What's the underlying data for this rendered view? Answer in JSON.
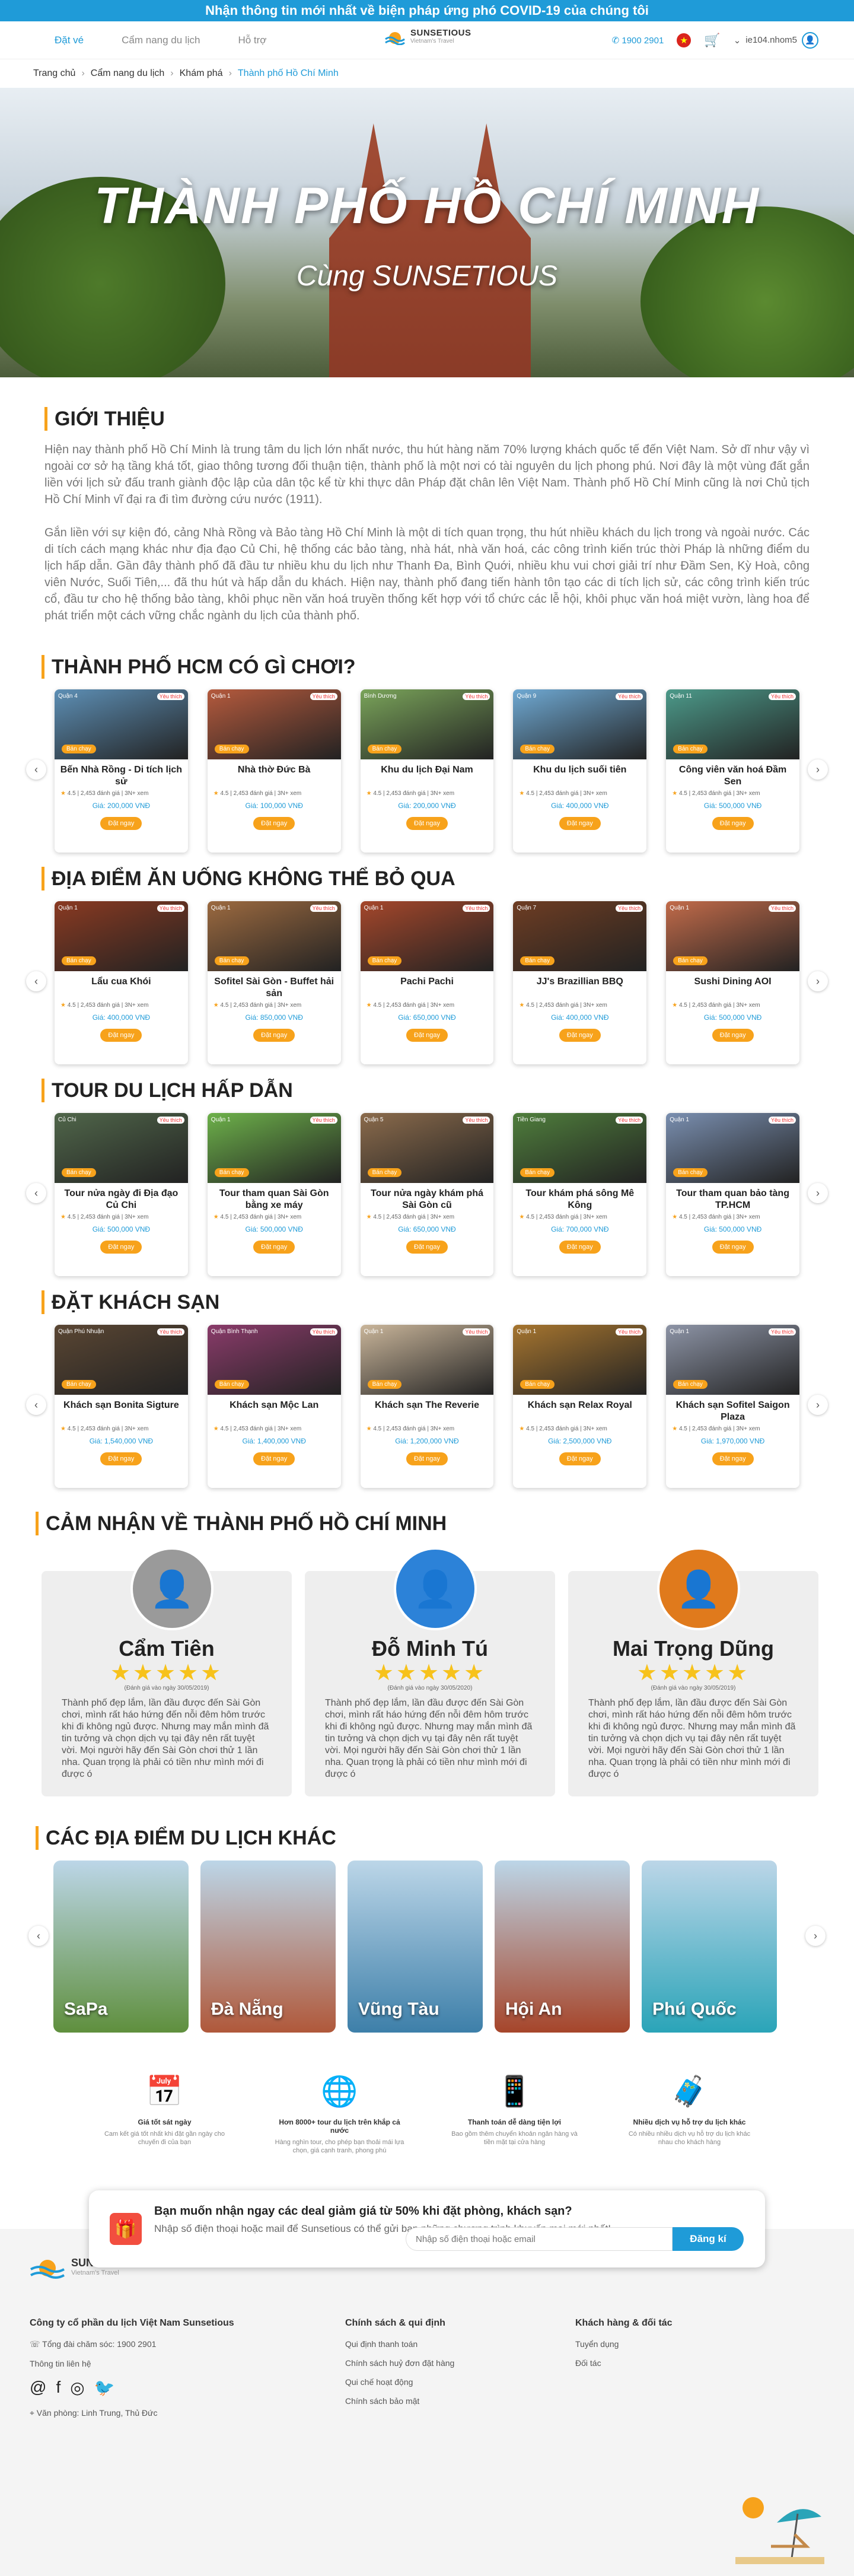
{
  "topbar": "Nhận thông tin mới nhất về biện pháp ứng phó COVID-19 của chúng tôi",
  "nav": {
    "links": [
      "Đặt vé",
      "Cẩm nang du lịch",
      "Hỗ trợ"
    ],
    "logo_title": "SUNSETIOUS",
    "logo_sub": "Vietnam's Travel",
    "phone": "1900 2901",
    "user": "ie104.nhom5"
  },
  "breadcrumb": [
    "Trang chủ",
    "Cẩm nang du lịch",
    "Khám phá",
    "Thành phố Hồ Chí Minh"
  ],
  "hero": {
    "title": "THÀNH PHỐ HỒ CHÍ MINH",
    "subtitle": "Cùng SUNSETIOUS"
  },
  "intro": {
    "title": "GIỚI THIỆU",
    "p1": "Hiện nay thành phố Hồ Chí Minh là trung tâm du lịch lớn nhất nước, thu hút hàng năm 70% lượng khách quốc tế đến Việt Nam. Sở dĩ như vậy vì ngoài cơ sở hạ tầng khá tốt, giao thông tương đối thuận tiện, thành phố là một nơi có tài nguyên du lịch phong phú. Nơi đây là một vùng đất gắn liền với lịch sử đấu tranh giành độc lập của dân tộc kể từ khi thực dân Pháp đặt chân lên Việt Nam. Thành phố Hồ Chí Minh cũng là nơi Chủ tịch Hồ Chí Minh vĩ đại ra đi tìm đường cứu nước (1911).",
    "p2": "Gắn liền với sự kiện đó, cảng Nhà Rồng và Bảo tàng Hồ Chí Minh là một di tích quan trọng, thu hút nhiều khách du lịch trong và ngoài nước. Các di tích cách mạng khác như địa đạo Củ Chi, hệ thống các bảo tàng, nhà hát, nhà văn hoá, các công trình kiến trúc thời Pháp là những điểm du lịch hấp dẫn. Gần đây thành phố đã đầu tư nhiều khu du lịch như Thanh Đa, Bình Quới, nhiều khu vui chơi giải trí như Đầm Sen, Kỳ Hoà, công viên Nước, Suối Tiên,... đã thu hút và hấp dẫn du khách. Hiện nay, thành phố đang tiến hành tôn tạo các di tích lịch sử, các công trình kiến trúc cổ, đầu tư cho hệ thống bảo tàng, khôi phục nền văn hoá truyền thống kết hợp với tổ chức các lễ hội, khôi phục văn hoá miệt vườn, làng hoa để phát triển một cách vững chắc ngành du lịch của thành phố."
  },
  "common": {
    "hot": "Yêu thích",
    "badge": "Bán chạy",
    "rating": "4.5",
    "meta": "| 2,453 đánh giá | 3N+ xem",
    "btn": "Đặt ngay"
  },
  "sections": [
    {
      "title": "THÀNH PHỐ HCM CÓ GÌ CHƠI?",
      "cards": [
        {
          "loc": "Quận 4",
          "name": "Bến Nhà Rồng - Di tích lịch sử",
          "price": "Giá: 200,000 VNĐ",
          "color": "#5d8fb5"
        },
        {
          "loc": "Quận 1",
          "name": "Nhà thờ Đức Bà",
          "price": "Giá: 100,000 VNĐ",
          "color": "#b55a3d"
        },
        {
          "loc": "Bình Dương",
          "name": "Khu du lịch Đại Nam",
          "price": "Giá: 200,000 VNĐ",
          "color": "#7aa45a"
        },
        {
          "loc": "Quận 9",
          "name": "Khu du lịch suối tiên",
          "price": "Giá: 400,000 VNĐ",
          "color": "#6fa9d3"
        },
        {
          "loc": "Quận 11",
          "name": "Công viên văn hoá Đầm Sen",
          "price": "Giá: 500,000 VNĐ",
          "color": "#4c9a8a"
        }
      ]
    },
    {
      "title": "ĐỊA ĐIỂM ĂN UỐNG KHÔNG THỂ BỎ QUA",
      "cards": [
        {
          "loc": "Quận 1",
          "name": "Lẩu cua Khói",
          "price": "Giá: 400,000 VNĐ",
          "color": "#8a3a22"
        },
        {
          "loc": "Quận 1",
          "name": "Sofitel Sài Gòn - Buffet hải sản",
          "price": "Giá: 850,000 VNĐ",
          "color": "#9c6a40"
        },
        {
          "loc": "Quận 1",
          "name": "Pachi Pachi",
          "price": "Giá: 650,000 VNĐ",
          "color": "#a5472b"
        },
        {
          "loc": "Quận 7",
          "name": "JJ's Brazillian BBQ",
          "price": "Giá: 400,000 VNĐ",
          "color": "#6e3d23"
        },
        {
          "loc": "Quận 1",
          "name": "Sushi Dining AOI",
          "price": "Giá: 500,000 VNĐ",
          "color": "#c26b4a"
        }
      ]
    },
    {
      "title": "TOUR DU LỊCH HẤP DẪN",
      "cards": [
        {
          "loc": "Củ Chi",
          "name": "Tour nửa ngày đi Địa đạo Củ Chi",
          "price": "Giá: 500,000 VNĐ",
          "color": "#50664a"
        },
        {
          "loc": "Quận 1",
          "name": "Tour tham quan Sài Gòn bằng xe máy",
          "price": "Giá: 500,000 VNĐ",
          "color": "#6db14a"
        },
        {
          "loc": "Quận 5",
          "name": "Tour nửa ngày khám phá Sài Gòn cũ",
          "price": "Giá: 650,000 VNĐ",
          "color": "#8b6b4c"
        },
        {
          "loc": "Tiền Giang",
          "name": "Tour khám phá sông Mê Kông",
          "price": "Giá: 700,000 VNĐ",
          "color": "#4f7e3c"
        },
        {
          "loc": "Quận 1",
          "name": "Tour tham quan bảo tàng TP.HCM",
          "price": "Giá: 500,000 VNĐ",
          "color": "#7a8fb0"
        }
      ]
    },
    {
      "title": "ĐẶT KHÁCH SẠN",
      "cards": [
        {
          "loc": "Quận Phú Nhuận",
          "name": "Khách sạn Bonita Sigture",
          "price": "Giá: 1,540,000 VNĐ",
          "color": "#5a4633"
        },
        {
          "loc": "Quận Bình Thạnh",
          "name": "Khách sạn Mộc Lan",
          "price": "Giá: 1,400,000 VNĐ",
          "color": "#8a3b6a"
        },
        {
          "loc": "Quận 1",
          "name": "Khách sạn The Reverie",
          "price": "Giá: 1,200,000 VNĐ",
          "color": "#c9b59a"
        },
        {
          "loc": "Quận 1",
          "name": "Khách sạn Relax Royal",
          "price": "Giá: 2,500,000 VNĐ",
          "color": "#a6752f"
        },
        {
          "loc": "Quận 1",
          "name": "Khách sạn Sofitel Saigon Plaza",
          "price": "Giá: 1,970,000 VNĐ",
          "color": "#8d94a6"
        }
      ]
    }
  ],
  "reviews": {
    "title": "CẢM NHẬN VỀ THÀNH PHỐ HỒ CHÍ MINH",
    "stars": "★★★★★",
    "items": [
      {
        "name": "Cẩm Tiên",
        "date": "(Đánh giá vào ngày 30/05/2019)",
        "text": "Thành phố đẹp lắm, lần đầu được đến Sài Gòn chơi, mình rất háo hứng đến nỗi đêm hôm trước khi đi không ngủ được. Nhưng may mắn mình đã tin tưởng và chọn dịch vụ tại đây nên rất tuyệt vời. Mọi người hãy đến Sài Gòn chơi thử 1 lần nha. Quan trọng là phải có tiền như mình mới đi được ó",
        "color": "#9a9a9a"
      },
      {
        "name": "Đỗ Minh Tú",
        "date": "(Đánh giá vào ngày 30/05/2020)",
        "text": "Thành phố đẹp lắm, lần đầu được đến Sài Gòn chơi, mình rất háo hứng đến nỗi đêm hôm trước khi đi không ngủ được. Nhưng may mắn mình đã tin tưởng và chọn dịch vụ tại đây nên rất tuyệt vời. Mọi người hãy đến Sài Gòn chơi thử 1 lần nha. Quan trọng là phải có tiền như mình mới đi được ó",
        "color": "#2c82d8"
      },
      {
        "name": "Mai Trọng Dũng",
        "date": "(Đánh giá vào ngày 30/05/2019)",
        "text": "Thành phố đẹp lắm, lần đầu được đến Sài Gòn chơi, mình rất háo hứng đến nỗi đêm hôm trước khi đi không ngủ được. Nhưng may mắn mình đã tin tưởng và chọn dịch vụ tại đây nên rất tuyệt vời. Mọi người hãy đến Sài Gòn chơi thử 1 lần nha. Quan trọng là phải có tiền như mình mới đi được ó",
        "color": "#e07a1c"
      }
    ]
  },
  "destinations": {
    "title": "CÁC ĐỊA ĐIỂM DU LỊCH KHÁC",
    "items": [
      {
        "name": "SaPa",
        "color": "#5f8f3d"
      },
      {
        "name": "Đà Nẵng",
        "color": "#b0583a"
      },
      {
        "name": "Vũng Tàu",
        "color": "#3d7fa9"
      },
      {
        "name": "Hội An",
        "color": "#a6452a"
      },
      {
        "name": "Phú Quốc",
        "color": "#2aa4b8"
      }
    ]
  },
  "features": [
    {
      "icon": "calendar-icon",
      "title": "Giá tốt sát ngày",
      "desc": "Cam kết giá tốt nhất khi đặt gần ngày cho chuyến đi của bạn"
    },
    {
      "icon": "globe-icon",
      "title": "Hơn 8000+ tour du lịch trên khắp cả nước",
      "desc": "Hàng nghìn tour, cho phép bạn thoải mái lựa chọn, giá cạnh tranh, phong phú"
    },
    {
      "icon": "phone-icon",
      "title": "Thanh toán dễ dàng tiện lợi",
      "desc": "Bao gồm thêm chuyển khoản ngân hàng và tiền mặt tại cửa hàng"
    },
    {
      "icon": "luggage-icon",
      "title": "Nhiều dịch vụ hỗ trợ du lịch khác",
      "desc": "Có nhiều nhiều dịch vụ hỗ trợ du lịch khác nhau cho khách hàng"
    }
  ],
  "newsletter": {
    "title": "Bạn muốn nhận ngay các deal giảm giá từ 50% khi đặt phòng, khách sạn?",
    "desc": "Nhập số điện thoại hoặc mail để Sunsetious có thể gửi bạn những chương trình khuyến mại mới nhất!",
    "placeholder": "Nhập số điện thoại hoặc email",
    "button": "Đăng kí"
  },
  "footer": {
    "logo_title": "SUNSETIOUS",
    "logo_sub": "Vietnam's Travel",
    "col1": {
      "title": "Công ty cổ phần du lịch Việt Nam Sunsetious",
      "lines": [
        "Tổng đài chăm sóc: 1900 2901",
        "Thông tin liên hệ"
      ],
      "address": "Văn phòng: Linh Trung, Thủ Đức"
    },
    "col2": {
      "title": "Chính sách & qui định",
      "lines": [
        "Qui định thanh toán",
        "Chính sách huỷ đơn đặt hàng",
        "Qui chế hoạt động",
        "Chính sách bảo mật"
      ]
    },
    "col3": {
      "title": "Khách hàng & đối tác",
      "lines": [
        "Tuyển dụng",
        "Đối tác"
      ]
    }
  }
}
